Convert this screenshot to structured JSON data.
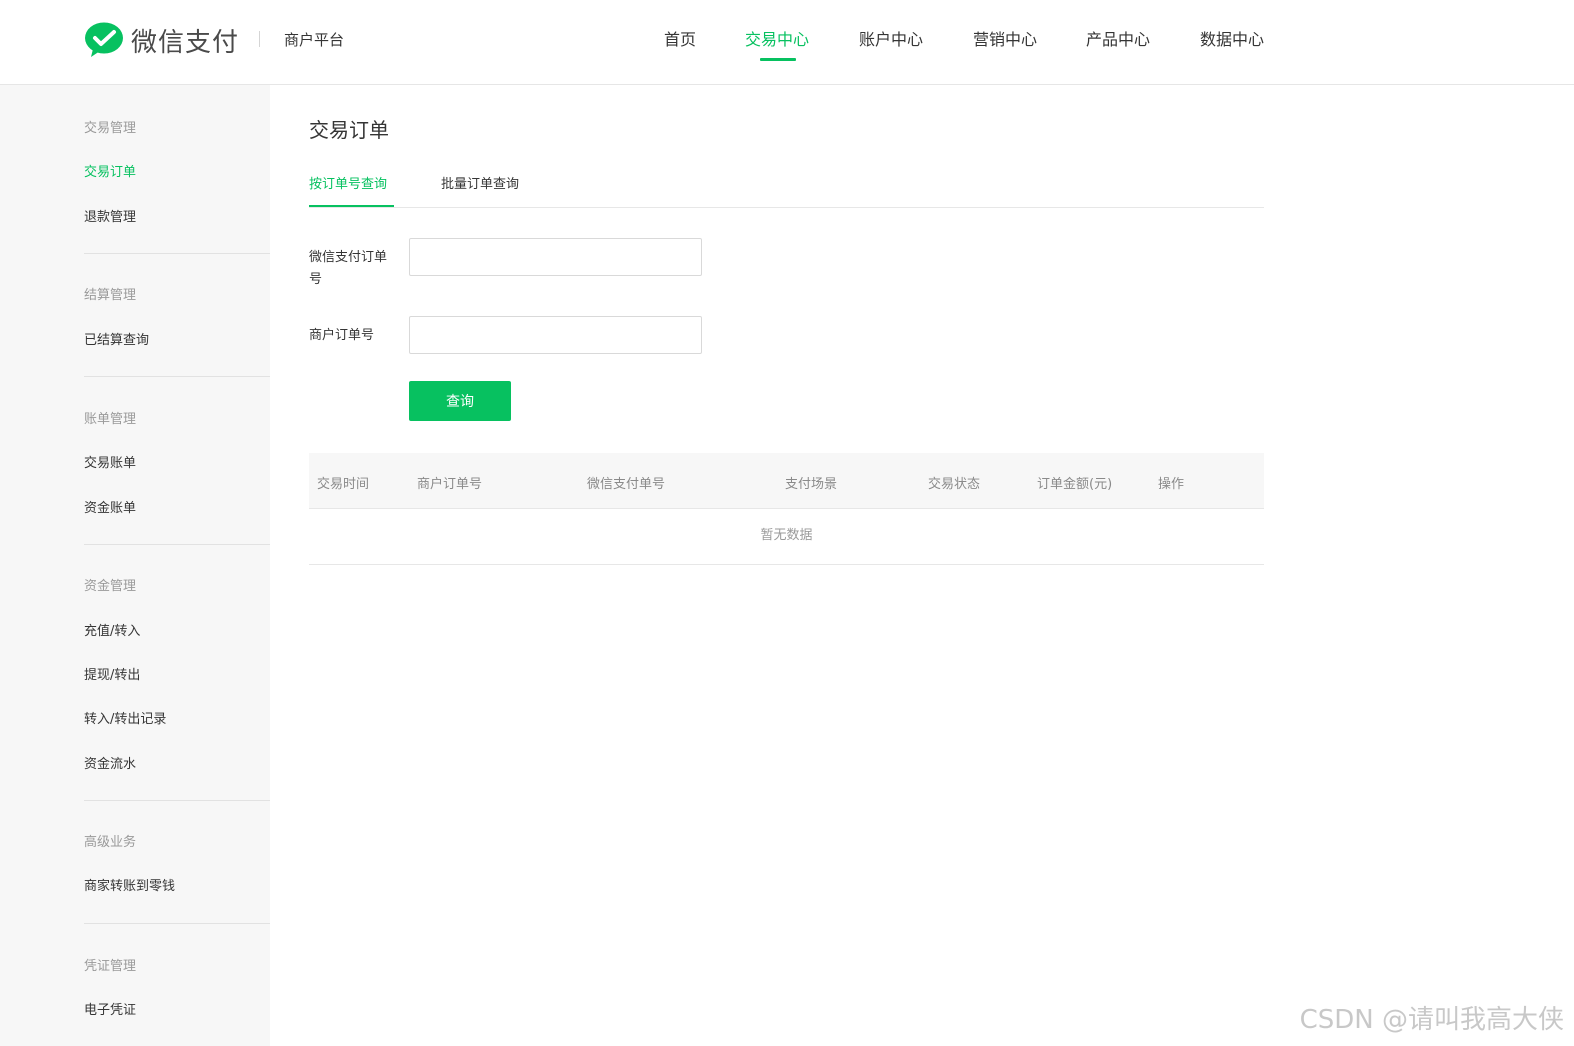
{
  "header": {
    "logo_text": "微信支付",
    "platform": "商户平台",
    "nav": [
      "首页",
      "交易中心",
      "账户中心",
      "营销中心",
      "产品中心",
      "数据中心"
    ],
    "active_nav": "交易中心"
  },
  "sidebar": {
    "groups": [
      {
        "title": "交易管理",
        "items": [
          "交易订单",
          "退款管理"
        ]
      },
      {
        "title": "结算管理",
        "items": [
          "已结算查询"
        ]
      },
      {
        "title": "账单管理",
        "items": [
          "交易账单",
          "资金账单"
        ]
      },
      {
        "title": "资金管理",
        "items": [
          "充值/转入",
          "提现/转出",
          "转入/转出记录",
          "资金流水"
        ]
      },
      {
        "title": "高级业务",
        "items": [
          "商家转账到零钱"
        ]
      },
      {
        "title": "凭证管理",
        "items": [
          "电子凭证"
        ]
      }
    ],
    "active_item": "交易订单"
  },
  "main": {
    "title": "交易订单",
    "tabs": [
      "按订单号查询",
      "批量订单查询"
    ],
    "form": {
      "wechat_order_label": "微信支付订单号",
      "wechat_order_value": "",
      "merchant_order_label": "商户订单号",
      "merchant_order_value": "",
      "query_button": "查询"
    },
    "table": {
      "columns": [
        "交易时间",
        "商户订单号",
        "微信支付单号",
        "支付场景",
        "交易状态",
        "订单金额(元)",
        "操作"
      ],
      "empty_text": "暂无数据"
    }
  },
  "watermark": "CSDN @请叫我高大侠",
  "colors": {
    "accent": "#07c160",
    "sidebar_bg": "#f7f7f7"
  }
}
